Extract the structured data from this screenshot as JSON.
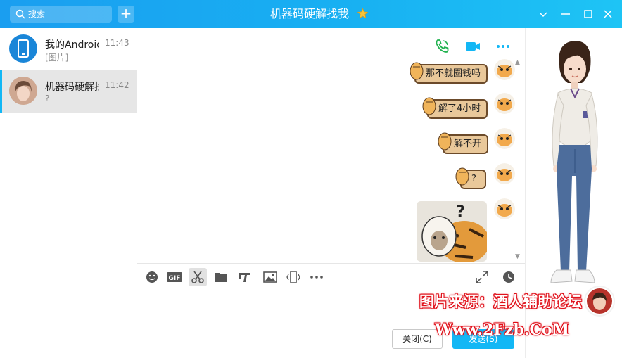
{
  "window": {
    "title": "机器码硬解找我",
    "search_placeholder": "搜索"
  },
  "conversations": [
    {
      "name": "我的Android手机",
      "time": "11:43",
      "preview": "[图片]"
    },
    {
      "name": "机器码硬解找我",
      "time": "11:42",
      "preview": "?"
    }
  ],
  "messages": [
    {
      "type": "text",
      "text": "那不就圈钱吗"
    },
    {
      "type": "text",
      "text": "解了4小时"
    },
    {
      "type": "text",
      "text": "解不开"
    },
    {
      "type": "text",
      "text": "?"
    },
    {
      "type": "sticker",
      "text": "?"
    }
  ],
  "toolbar": {
    "gif_label": "GIF",
    "close_label": "关闭(C)",
    "send_label": "发送(S)"
  },
  "watermark": {
    "line1": "图片来源：酒人辅助论坛",
    "line2": "Www.2Fzb.CoM"
  },
  "colors": {
    "accent": "#12b7f5",
    "bubble": "#e9c89a"
  }
}
